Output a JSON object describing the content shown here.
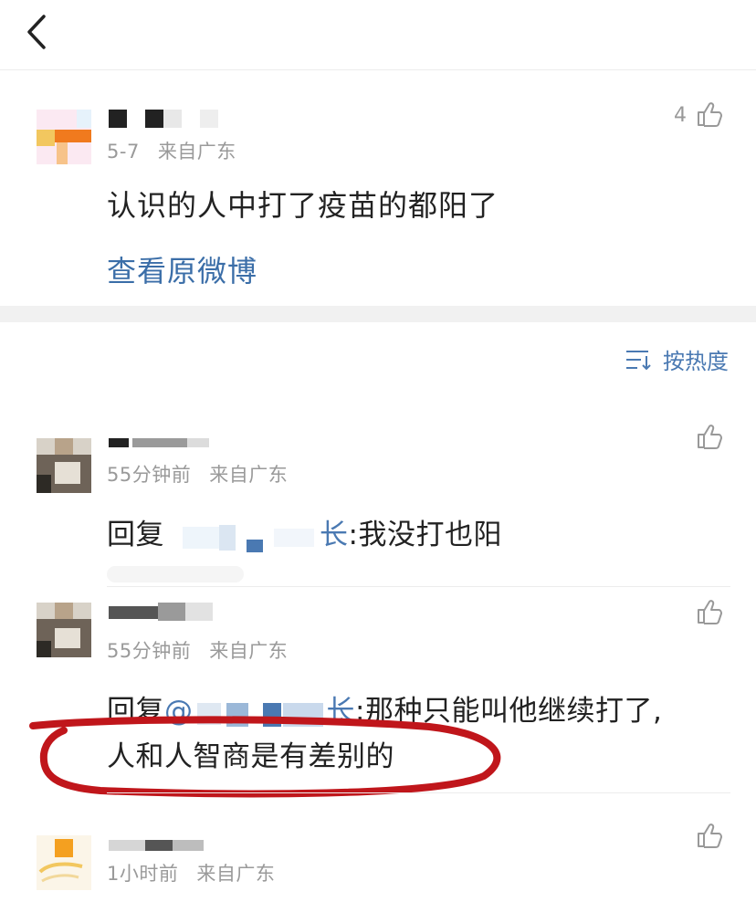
{
  "header": {
    "back_icon": "chevron-left-icon"
  },
  "post": {
    "meta_date": "5-7",
    "meta_location": "来自广东",
    "like_count": "4",
    "text": "认识的人中打了疫苗的都阳了",
    "view_original_label": "查看原微博"
  },
  "sort": {
    "label": "按热度",
    "icon": "sort-icon"
  },
  "comments": [
    {
      "time": "55分钟前",
      "location": "来自广东",
      "reply_prefix": "回复",
      "mention_suffix": "长",
      "content": ":我没打也阳"
    },
    {
      "time": "55分钟前",
      "location": "来自广东",
      "reply_prefix": "回复",
      "mention_at": "@",
      "mention_suffix": "长",
      "content_line1": ":那种只能叫他继续打了,",
      "content_line2": "人和人智商是有差别的"
    },
    {
      "time": "1小时前",
      "location": "来自广东"
    }
  ],
  "colors": {
    "link_blue": "#3b6ea8",
    "annotation_red": "#c0161b",
    "meta_gray": "#9a9a9a"
  }
}
